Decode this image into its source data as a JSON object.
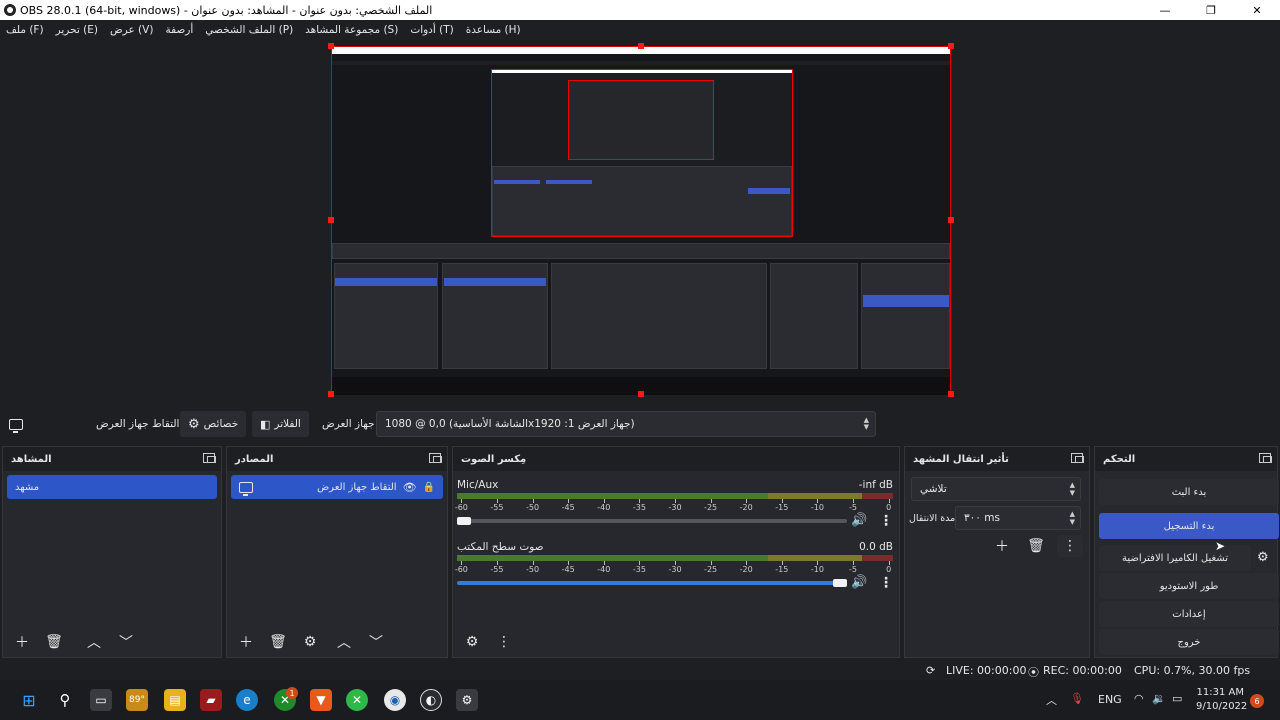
{
  "window": {
    "title": "OBS 28.0.1 (64-bit, windows) - الملف الشخصي: بدون عنوان - المشاهد: بدون عنوان",
    "minimize": "—",
    "maximize": "❐",
    "close": "✕"
  },
  "menu": [
    "ملف (F)",
    "تحرير (E)",
    "عرض (V)",
    "أرصفة",
    "الملف الشخصي (P)",
    "مجموعة المشاهد (S)",
    "أدوات (T)",
    "مساعدة (H)"
  ],
  "toolbar": {
    "capture_name": "التقاط جهاز العرض",
    "properties": "خصائص",
    "filters": "الفلاتر",
    "display_label": "جهاز العرض",
    "display_value": "الشاشة الأساسية) 0,0 @ 1080x1920 :جهاز العرض 1)"
  },
  "docks": {
    "scenes": {
      "title": "المشاهد",
      "items": [
        "مشهد"
      ]
    },
    "sources": {
      "title": "المصادر",
      "items": [
        "التقاط جهاز العرض"
      ]
    },
    "mixer": {
      "title": "مِكسر الصوت",
      "ticks": [
        "-60",
        "-55",
        "-50",
        "-45",
        "-40",
        "-35",
        "-30",
        "-25",
        "-20",
        "-15",
        "-10",
        "-5",
        "0"
      ],
      "channels": [
        {
          "name": "Mic/Aux",
          "db": "-inf dB",
          "level": 0.0,
          "volume": 0.0
        },
        {
          "name": "صوت سطح المكتب",
          "db": "0.0 dB",
          "level": 0.0,
          "volume": 1.0
        }
      ]
    },
    "transitions": {
      "title": "تأثير انتقال المشهد",
      "type": "تلاشي",
      "duration_label": "مدة الانتقال",
      "duration_value": "٣٠٠ ms"
    },
    "controls": {
      "title": "التحكم",
      "buttons": [
        "بدء البث",
        "بدء التسجيل",
        "تشغيل الكاميرا الافتراضية",
        "طور الاستوديو",
        "إعدادات",
        "خروج"
      ]
    }
  },
  "status": {
    "live": "LIVE: 00:00:00",
    "rec": "REC: 00:00:00",
    "cpu": "CPU: 0.7%, 30.00 fps"
  },
  "taskbar": {
    "weather": "89°",
    "lang": "ENG",
    "time": "11:31 AM",
    "date": "9/10/2022",
    "notifications": "6",
    "badge": "1"
  },
  "colors": {
    "accent": "#3a58c6",
    "selection": "#2d57c9",
    "handle": "#ff1a1a",
    "background": "#1e1f22"
  }
}
